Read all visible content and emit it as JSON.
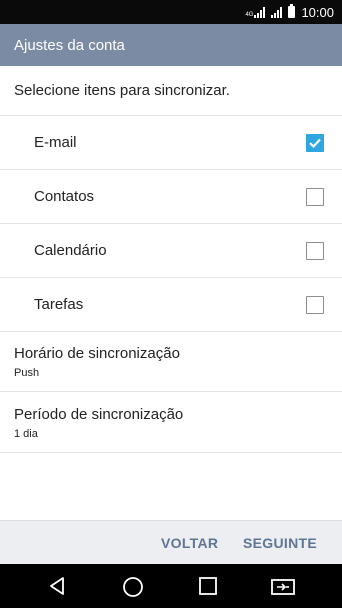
{
  "status_bar": {
    "time": "10:00",
    "network_label": "4G",
    "icons": [
      "lte-signal-icon",
      "signal-icon",
      "battery-icon"
    ]
  },
  "app_bar": {
    "title": "Ajustes da conta"
  },
  "section": {
    "header": "Selecione itens para sincronizar."
  },
  "sync_items": [
    {
      "label": "E-mail",
      "checked": true
    },
    {
      "label": "Contatos",
      "checked": false
    },
    {
      "label": "Calendário",
      "checked": false
    },
    {
      "label": "Tarefas",
      "checked": false
    }
  ],
  "settings": [
    {
      "title": "Horário de sincronização",
      "value": "Push"
    },
    {
      "title": "Período de sincronização",
      "value": "1 dia"
    }
  ],
  "footer": {
    "back_label": "VOLTAR",
    "next_label": "SEGUINTE"
  },
  "nav_bar": {
    "icons": [
      "back-triangle-icon",
      "home-circle-icon",
      "recents-square-icon",
      "dual-window-icon"
    ]
  },
  "colors": {
    "app_bar": "#7b8ba4",
    "accent": "#2ea7e0",
    "button_text": "#5f7596"
  }
}
